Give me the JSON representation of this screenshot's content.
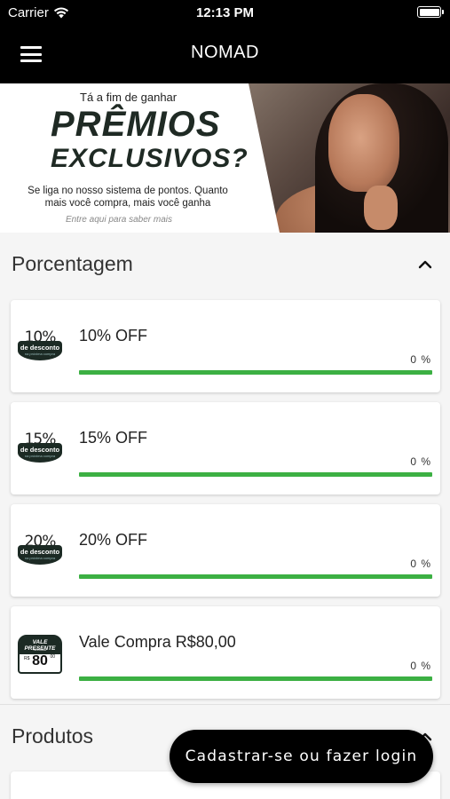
{
  "status_bar": {
    "carrier": "Carrier",
    "time": "12:13 PM",
    "battery_level": 1.0
  },
  "nav": {
    "title": "NOMAD",
    "menu_icon": "hamburger-menu-icon"
  },
  "banner": {
    "line1": "Tá a fim de ganhar",
    "headline1": "PRÊMIOS",
    "headline2": "EXCLUSIVOS?",
    "body": "Se liga no nosso sistema de pontos. Quanto mais você compra, mais você ganha",
    "cta": "Entre aqui para saber mais"
  },
  "sections": {
    "percentage": {
      "label": "Porcentagem",
      "expanded": true,
      "chevron_icon": "chevron-up-icon"
    },
    "products": {
      "label": "Produtos",
      "expanded": true,
      "chevron_icon": "chevron-up-icon"
    }
  },
  "rewards": [
    {
      "badge_value": "10%",
      "badge_text": "de desconto",
      "badge_sub": "na próxima compra",
      "name": "10% OFF",
      "progress_label": "0 %",
      "progress": 0
    },
    {
      "badge_value": "15%",
      "badge_text": "de desconto",
      "badge_sub": "na próxima compra",
      "name": "15% OFF",
      "progress_label": "0 %",
      "progress": 0
    },
    {
      "badge_value": "20%",
      "badge_text": "de desconto",
      "badge_sub": "na próxima compra",
      "name": "20% OFF",
      "progress_label": "0 %",
      "progress": 0
    },
    {
      "badge_title": "VALE PRESENTE",
      "badge_brand": "NOMAD",
      "badge_currency": "R$",
      "badge_value": "80",
      "badge_cents": "00",
      "name": "Vale Compra R$80,00",
      "progress_label": "0 %",
      "progress": 0
    }
  ],
  "login_button": {
    "label": "Cadastrar-se ou fazer login"
  },
  "colors": {
    "accent_green": "#3cb043",
    "bar_black": "#000000",
    "badge_dark": "#1c2a24"
  }
}
